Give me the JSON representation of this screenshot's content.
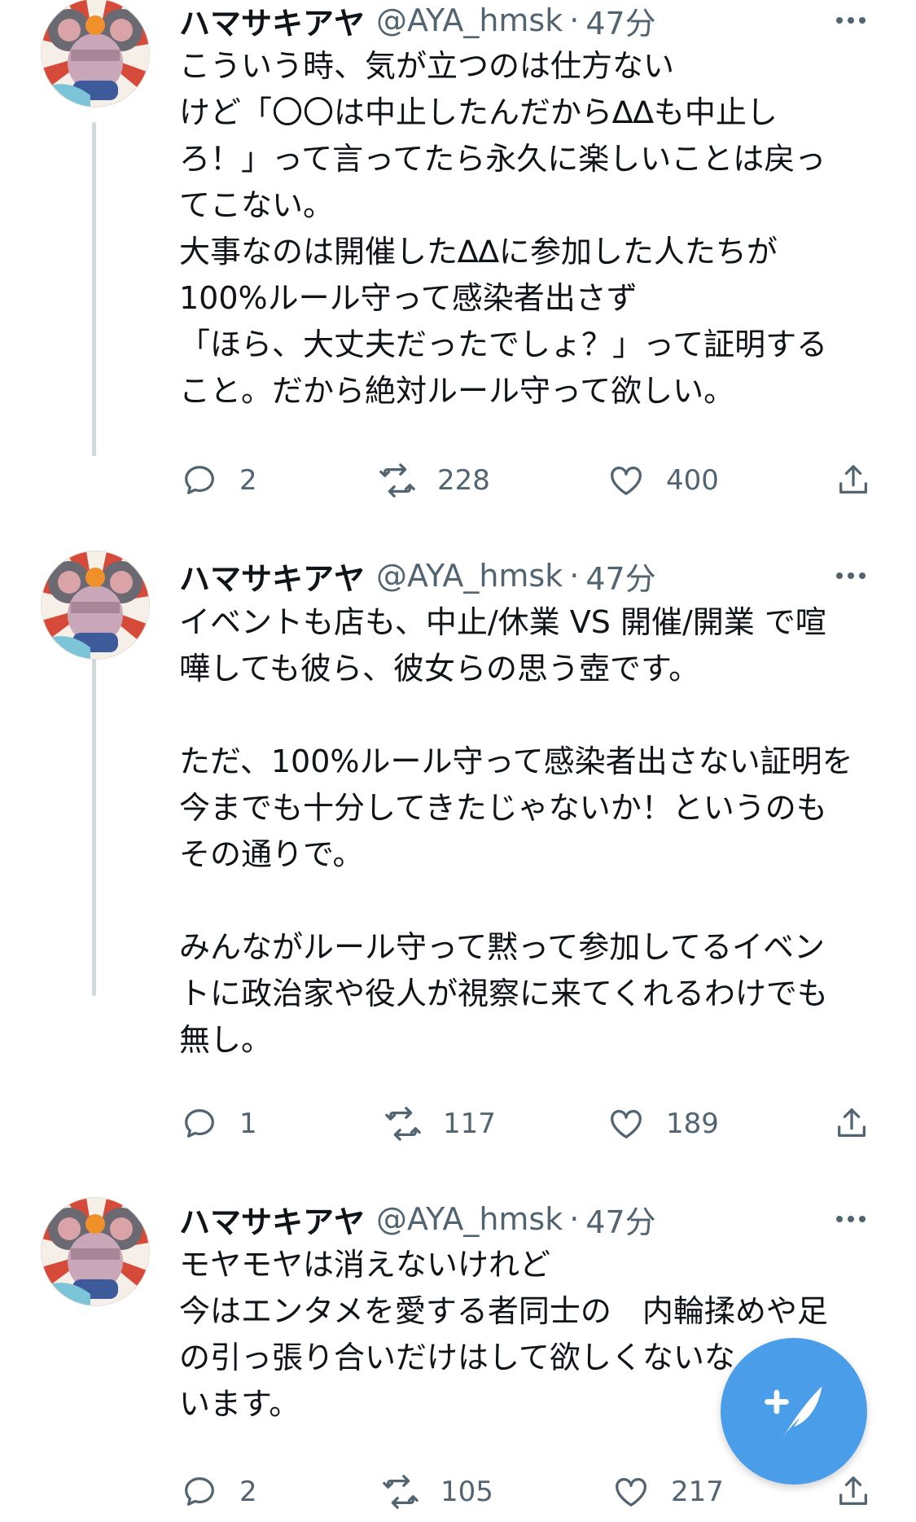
{
  "tweets": [
    {
      "name": "ハマサキアヤ",
      "handle": "@AYA_hmsk",
      "separator": "·",
      "time": "47分",
      "text_lines": [
        "こういう時、気が立つのは仕方ない",
        "けど「〇〇は中止したんだから∆∆も中止し",
        "ろ！」って言ってたら永久に楽しいことは戻っ",
        "てこない。",
        "大事なのは開催した∆∆に参加した人たちが",
        "100%ルール守って感染者出さず",
        "「ほら、大丈夫だったでしょ？」って証明する",
        "こと。だから絶対ルール守って欲しい。"
      ],
      "replies": "2",
      "retweets": "228",
      "likes": "400"
    },
    {
      "name": "ハマサキアヤ",
      "handle": "@AYA_hmsk",
      "separator": "·",
      "time": "47分",
      "text_lines": [
        "イベントも店も、中止/休業 VS 開催/開業 で喧",
        "嘩しても彼ら、彼女らの思う壺です。",
        "",
        "ただ、100%ルール守って感染者出さない証明を",
        "今までも十分してきたじゃないか！というのも",
        "その通りで。",
        "",
        "みんながルール守って黙って参加してるイベン",
        "トに政治家や役人が視察に来てくれるわけでも",
        "無し。"
      ],
      "replies": "1",
      "retweets": "117",
      "likes": "189"
    },
    {
      "name": "ハマサキアヤ",
      "handle": "@AYA_hmsk",
      "separator": "·",
      "time": "47分",
      "text_lines": [
        "モヤモヤは消えないけれど",
        "今はエンタメを愛する者同士の　内輪揉めや足",
        "の引っ張り合いだけはして欲しくないな",
        "います。"
      ],
      "replies": "2",
      "retweets": "105",
      "likes": "217"
    }
  ],
  "icons": {
    "reply": "reply-icon",
    "retweet": "retweet-icon",
    "like": "heart-icon",
    "share": "share-icon",
    "more": "more-icon",
    "compose": "compose-tweet-icon"
  },
  "colors": {
    "accent": "#4a9ee9",
    "secondary_text": "#536471",
    "thread_line": "#cfd9de"
  }
}
